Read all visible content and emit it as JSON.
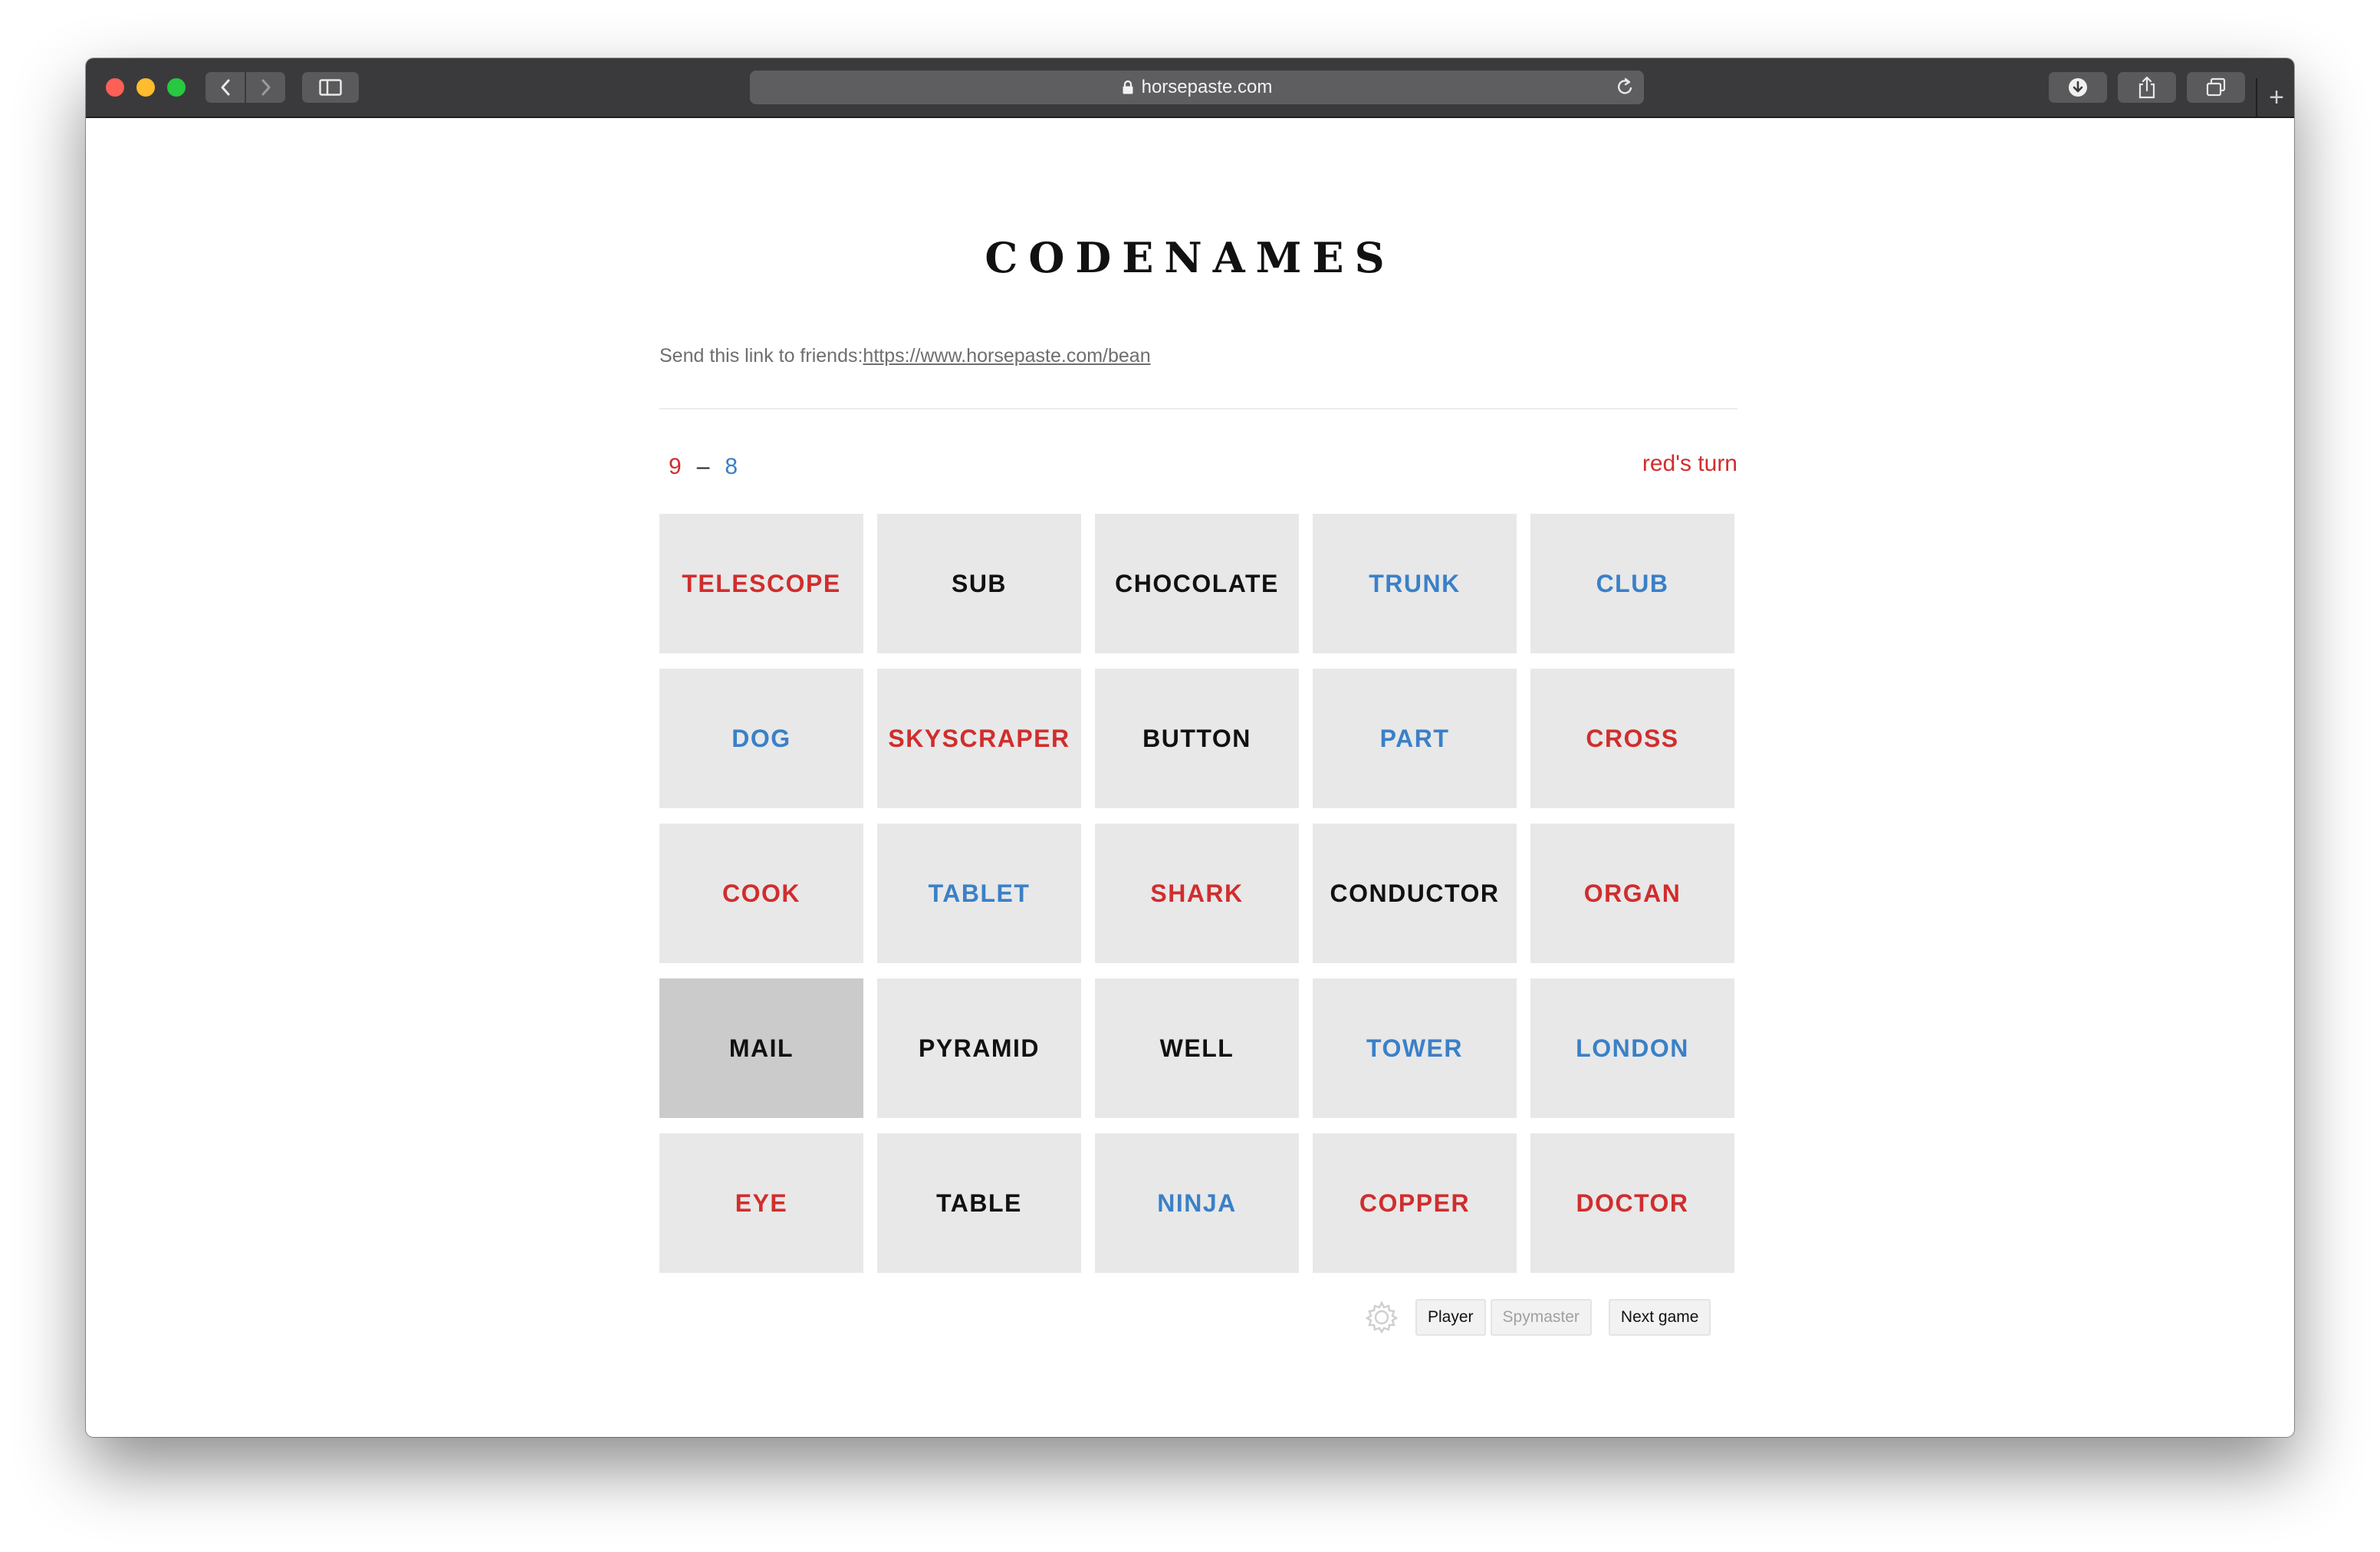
{
  "browser": {
    "url": "horsepaste.com"
  },
  "page": {
    "title": "CODENAMES",
    "share_prefix": "Send this link to friends:",
    "share_link": "https://www.horsepaste.com/bean",
    "score": {
      "red": "9",
      "separator": "–",
      "blue": "8"
    },
    "turn": "red's turn"
  },
  "board": [
    {
      "word": "TELESCOPE",
      "team": "red"
    },
    {
      "word": "SUB",
      "team": "neutral"
    },
    {
      "word": "CHOCOLATE",
      "team": "neutral"
    },
    {
      "word": "TRUNK",
      "team": "blue"
    },
    {
      "word": "CLUB",
      "team": "blue"
    },
    {
      "word": "DOG",
      "team": "blue"
    },
    {
      "word": "SKYSCRAPER",
      "team": "red"
    },
    {
      "word": "BUTTON",
      "team": "neutral"
    },
    {
      "word": "PART",
      "team": "blue"
    },
    {
      "word": "CROSS",
      "team": "red"
    },
    {
      "word": "COOK",
      "team": "red"
    },
    {
      "word": "TABLET",
      "team": "blue"
    },
    {
      "word": "SHARK",
      "team": "red"
    },
    {
      "word": "CONDUCTOR",
      "team": "neutral"
    },
    {
      "word": "ORGAN",
      "team": "red"
    },
    {
      "word": "MAIL",
      "team": "neutral",
      "revealed": true
    },
    {
      "word": "PYRAMID",
      "team": "neutral"
    },
    {
      "word": "WELL",
      "team": "neutral"
    },
    {
      "word": "TOWER",
      "team": "blue"
    },
    {
      "word": "LONDON",
      "team": "blue"
    },
    {
      "word": "EYE",
      "team": "red"
    },
    {
      "word": "TABLE",
      "team": "neutral"
    },
    {
      "word": "NINJA",
      "team": "blue"
    },
    {
      "word": "COPPER",
      "team": "red"
    },
    {
      "word": "DOCTOR",
      "team": "red"
    }
  ],
  "controls": {
    "settings_icon": "gear-icon",
    "player_label": "Player",
    "spymaster_label": "Spymaster",
    "next_game_label": "Next game",
    "active_role": "Player"
  },
  "colors": {
    "red": "#d12d2d",
    "blue": "#3a80c8",
    "card_bg": "#e8e8e8",
    "card_revealed_bg": "#cbcbcb"
  }
}
